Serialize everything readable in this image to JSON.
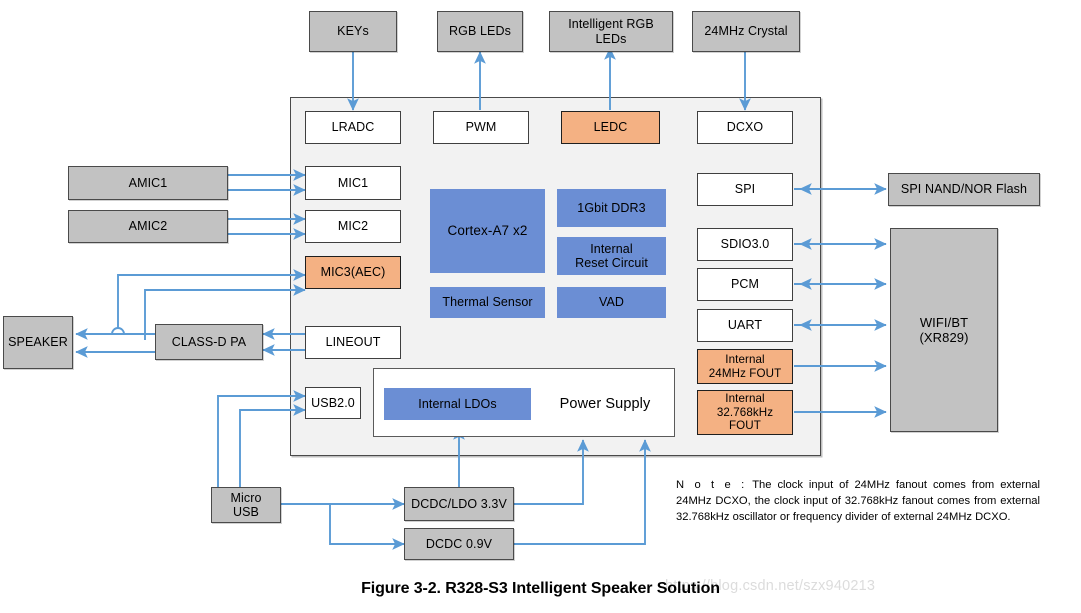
{
  "figure": {
    "caption": "Figure 3-2. R328-S3 Intelligent Speaker Solution",
    "watermark": "https://blog.csdn.net/szx940213"
  },
  "colors": {
    "gray_block": "#c2c2c2",
    "orange_block": "#f4b183",
    "blue_block": "#6b8ed4",
    "white_block": "#ffffff",
    "soc_background": "#f2f2f2",
    "wire": "#5b9bd5",
    "border": "#4a4a4a"
  },
  "external_top": [
    {
      "id": "keys",
      "label": "KEYs"
    },
    {
      "id": "rgb_leds",
      "label": "RGB LEDs"
    },
    {
      "id": "intelligent_rgb_leds",
      "label": "Intelligent RGB\nLEDs"
    },
    {
      "id": "crystal_24mhz",
      "label": "24MHz Crystal"
    }
  ],
  "external_left": [
    {
      "id": "amic1",
      "label": "AMIC1"
    },
    {
      "id": "amic2",
      "label": "AMIC2"
    },
    {
      "id": "speaker",
      "label": "SPEAKER"
    },
    {
      "id": "class_d_pa",
      "label": "CLASS-D PA"
    },
    {
      "id": "micro_usb",
      "label": "Micro\nUSB"
    }
  ],
  "external_right": [
    {
      "id": "spi_flash",
      "label": "SPI NAND/NOR Flash"
    },
    {
      "id": "wifi_bt",
      "label": "WIFI/BT\n(XR829)"
    }
  ],
  "external_bottom": [
    {
      "id": "dcdc_ldo_33v",
      "label": "DCDC/LDO 3.3V"
    },
    {
      "id": "dcdc_09v",
      "label": "DCDC 0.9V"
    }
  ],
  "soc_peripherals_top": [
    {
      "id": "lradc",
      "label": "LRADC",
      "style": "white"
    },
    {
      "id": "pwm",
      "label": "PWM",
      "style": "white"
    },
    {
      "id": "ledc",
      "label": "LEDC",
      "style": "orange"
    },
    {
      "id": "dcxo",
      "label": "DCXO",
      "style": "white"
    }
  ],
  "soc_peripherals_left": [
    {
      "id": "mic1",
      "label": "MIC1",
      "style": "white"
    },
    {
      "id": "mic2",
      "label": "MIC2",
      "style": "white"
    },
    {
      "id": "mic3_aec",
      "label": "MIC3(AEC)",
      "style": "orange"
    },
    {
      "id": "lineout",
      "label": "LINEOUT",
      "style": "white"
    },
    {
      "id": "usb20",
      "label": "USB2.0",
      "style": "white"
    }
  ],
  "soc_peripherals_right": [
    {
      "id": "spi",
      "label": "SPI",
      "style": "white"
    },
    {
      "id": "sdio30",
      "label": "SDIO3.0",
      "style": "white"
    },
    {
      "id": "pcm",
      "label": "PCM",
      "style": "white"
    },
    {
      "id": "uart",
      "label": "UART",
      "style": "white"
    },
    {
      "id": "internal_24mhz_fout",
      "label": "Internal\n24MHz FOUT",
      "style": "orange"
    },
    {
      "id": "internal_32768khz_fout",
      "label": "Internal\n32.768kHz\nFOUT",
      "style": "orange"
    }
  ],
  "soc_core": [
    {
      "id": "cortex_a7",
      "label": "Cortex-A7 x2",
      "style": "blue"
    },
    {
      "id": "ddr3",
      "label": "1Gbit DDR3",
      "style": "blue"
    },
    {
      "id": "internal_reset",
      "label": "Internal\nReset Circuit",
      "style": "blue"
    },
    {
      "id": "thermal_sensor",
      "label": "Thermal Sensor",
      "style": "blue"
    },
    {
      "id": "vad",
      "label": "VAD",
      "style": "blue"
    }
  ],
  "soc_power": {
    "title": "Power Supply",
    "internal_ldos": "Internal LDOs"
  },
  "note": {
    "label": "N o t e :",
    "text": "The clock input of 24MHz fanout comes from external 24MHz DCXO, the clock input of 32.768kHz fanout comes from external 32.768kHz oscillator or frequency divider of external 24MHz DCXO."
  }
}
